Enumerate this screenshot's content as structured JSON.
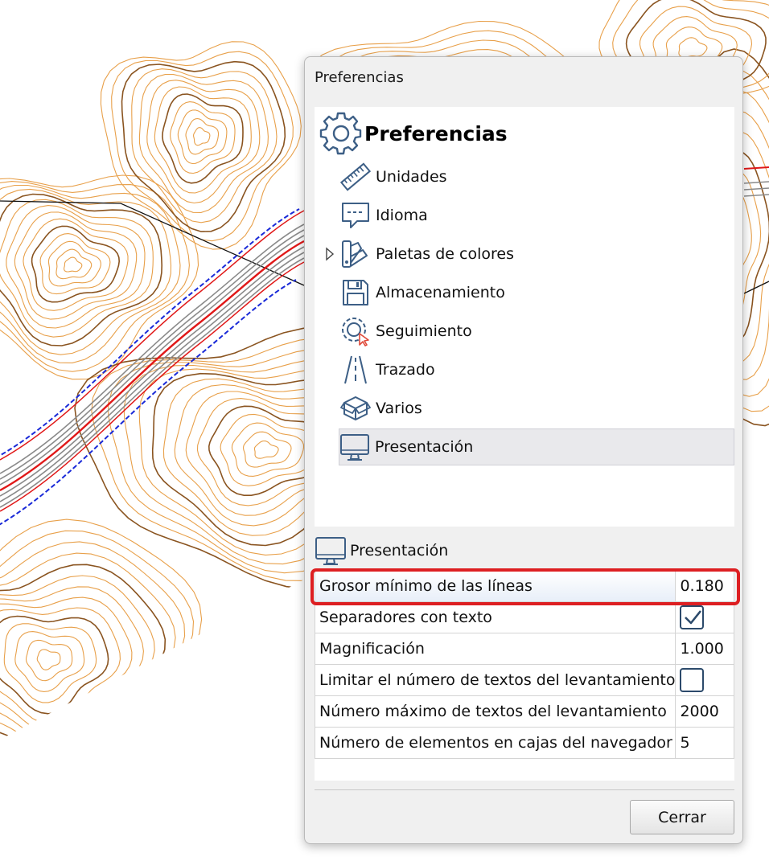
{
  "background": {
    "contour_color": "#e8a04a",
    "index_contour_color": "#8a5420",
    "axis_color": "#e01818",
    "edge_color": "#1a2ad8"
  },
  "dialog": {
    "title": "Preferencias",
    "tree": {
      "header": {
        "label": "Preferencias",
        "icon": "gear-icon"
      },
      "items": [
        {
          "label": "Unidades",
          "icon": "ruler-icon",
          "selected": false,
          "expandable": false
        },
        {
          "label": "Idioma",
          "icon": "speech-bubble-icon",
          "selected": false,
          "expandable": false
        },
        {
          "label": "Paletas de colores",
          "icon": "color-palette-icon",
          "selected": false,
          "expandable": true
        },
        {
          "label": "Almacenamiento",
          "icon": "floppy-disk-icon",
          "selected": false,
          "expandable": false
        },
        {
          "label": "Seguimiento",
          "icon": "tracking-cursor-icon",
          "selected": false,
          "expandable": false
        },
        {
          "label": "Trazado",
          "icon": "road-icon",
          "selected": false,
          "expandable": false
        },
        {
          "label": "Varios",
          "icon": "boxes-icon",
          "selected": false,
          "expandable": false
        },
        {
          "label": "Presentación",
          "icon": "monitor-icon",
          "selected": true,
          "expandable": false
        }
      ]
    },
    "section": {
      "label": "Presentación",
      "icon": "monitor-icon"
    },
    "properties": [
      {
        "name": "Grosor mínimo de las líneas",
        "value": "0.180",
        "type": "text"
      },
      {
        "name": "Separadores con texto",
        "value": "",
        "type": "checkbox",
        "checked": true
      },
      {
        "name": "Magnificación",
        "value": "1.000",
        "type": "text"
      },
      {
        "name": "Limitar el número de textos del levantamiento",
        "value": "",
        "type": "checkbox",
        "checked": false
      },
      {
        "name": "Número máximo de textos del levantamiento",
        "value": "2000",
        "type": "text"
      },
      {
        "name": "Número de elementos en cajas del navegador",
        "value": "5",
        "type": "text"
      }
    ],
    "highlight_color": "#dd1f22",
    "close_label": "Cerrar"
  }
}
